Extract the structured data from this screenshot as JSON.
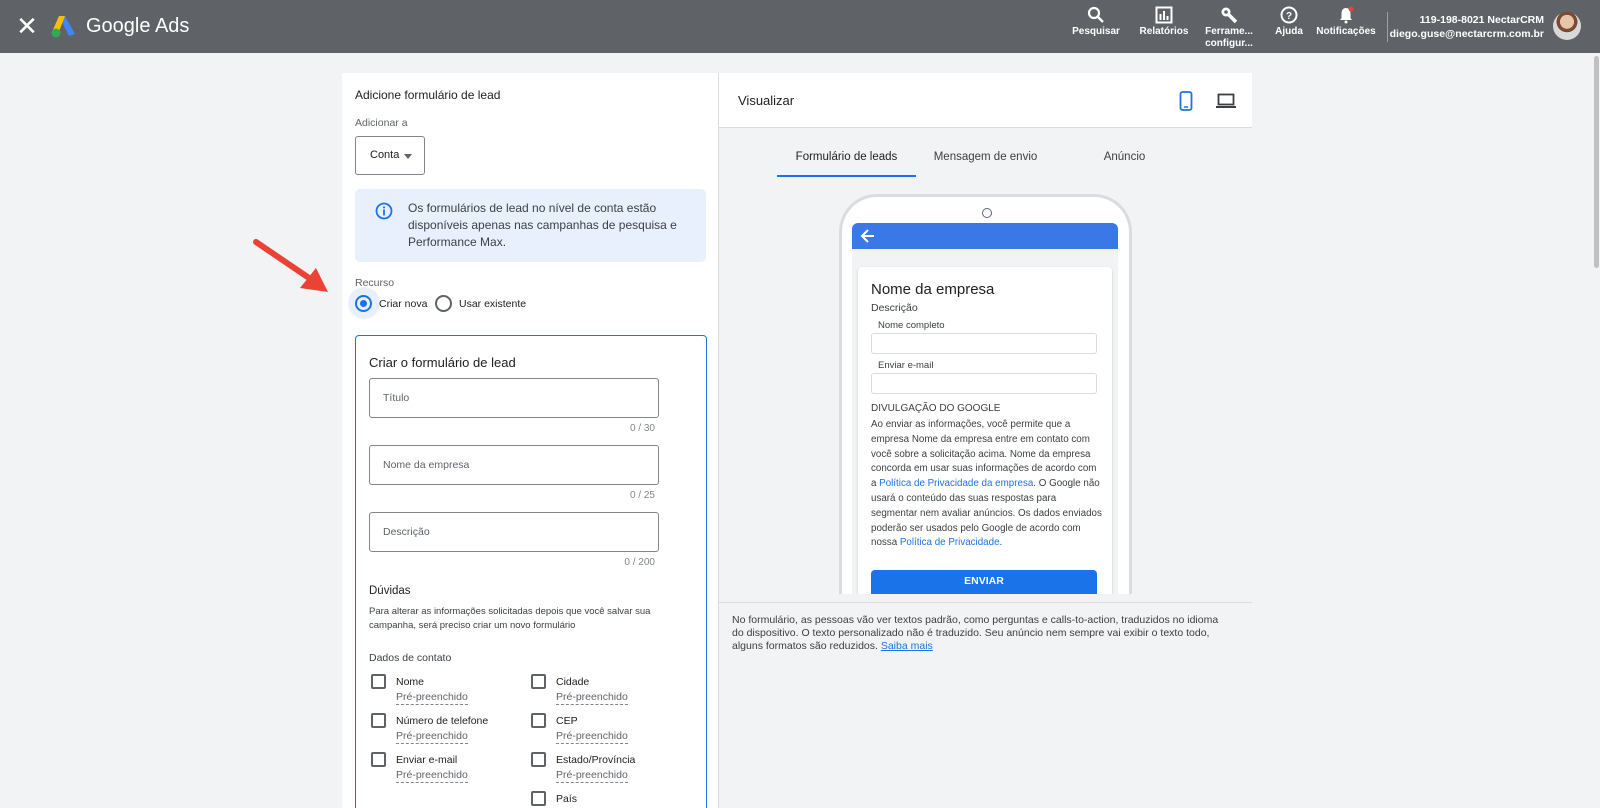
{
  "topbar": {
    "brand": "Google Ads",
    "items": [
      {
        "label": "Pesquisar",
        "icon": "search-icon"
      },
      {
        "label": "Relatórios",
        "icon": "chart-icon"
      },
      {
        "label": "Ferrame... configur...",
        "icon": "wrench-icon"
      },
      {
        "label": "Ajuda",
        "icon": "help-icon"
      },
      {
        "label": "Notificações",
        "icon": "bell-icon"
      }
    ],
    "tools_line1": "Ferrame...",
    "tools_line2": "configur...",
    "account_id": "119-198-8021 NectarCRM",
    "account_email": "diego.guse@nectarcrm.com.br"
  },
  "left": {
    "title": "Adicione formulário de lead",
    "add_to_label": "Adicionar a",
    "add_to_value": "Conta",
    "info_text": "Os formulários de lead no nível de conta estão disponíveis apenas nas campanhas de pesquisa e Performance Max.",
    "resource_label": "Recurso",
    "radio_new": "Criar nova",
    "radio_existing": "Usar existente",
    "form": {
      "title": "Criar o formulário de lead",
      "fields": [
        {
          "placeholder": "Título",
          "counter": "0 / 30"
        },
        {
          "placeholder": "Nome da empresa",
          "counter": "0 / 25"
        },
        {
          "placeholder": "Descrição",
          "counter": "0 / 200"
        }
      ],
      "doubts_title": "Dúvidas",
      "doubts_text": "Para alterar as informações solicitadas depois que você salvar sua campanha, será preciso criar um novo formulário",
      "contact_title": "Dados de contato",
      "prefilled": "Pré-preenchido",
      "checkboxes_left": [
        "Nome",
        "Número de telefone",
        "Enviar e-mail"
      ],
      "checkboxes_right": [
        "Cidade",
        "CEP",
        "Estado/Província",
        "País"
      ]
    }
  },
  "right": {
    "title": "Visualizar",
    "tabs": [
      "Formulário de leads",
      "Mensagem de envio",
      "Anúncio"
    ],
    "preview": {
      "company": "Nome da empresa",
      "description": "Descrição",
      "field1": "Nome completo",
      "field2": "Enviar e-mail",
      "disclosure_title": "DIVULGAÇÃO DO GOOGLE",
      "disclosure_a": "Ao enviar as informações, você permite que a empresa Nome da empresa entre em contato com você sobre a solicitação acima. Nome da empresa concorda em usar suas informações de acordo com a ",
      "disclosure_link1": "Política de Privacidade da empresa",
      "disclosure_b": ". O Google não usará o conteúdo das suas respostas para segmentar nem avaliar anúncios. Os dados enviados poderão ser usados pelo Google de acordo com nossa ",
      "disclosure_link2": "Política de Privacidade",
      "disclosure_c": ".",
      "submit": "ENVIAR"
    },
    "footer_text": "No formulário, as pessoas vão ver textos padrão, como perguntas e calls-to-action, traduzidos no idioma do dispositivo. O texto personalizado não é traduzido. Seu anúncio nem sempre vai exibir o texto todo, alguns formatos são reduzidos.",
    "footer_link": "Saiba mais"
  },
  "colors": {
    "topbar": "#5f6368",
    "accent": "#1a73e8",
    "info_bg": "#e8f0fe",
    "annotation_arrow": "#ea4335"
  }
}
